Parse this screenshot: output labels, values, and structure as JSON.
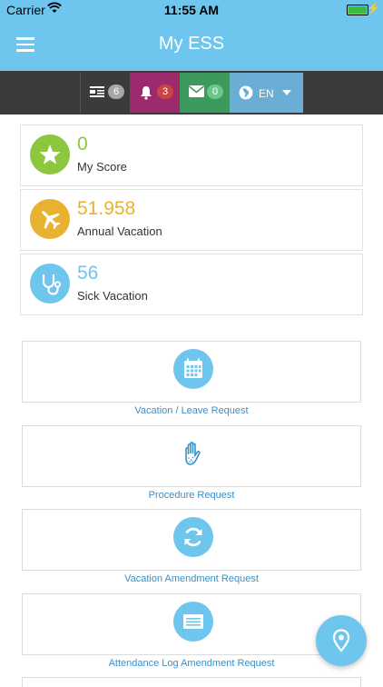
{
  "status_bar": {
    "carrier": "Carrier",
    "time": "11:55 AM"
  },
  "app": {
    "title": "My ESS"
  },
  "toolbar": {
    "news_count": "6",
    "notifications_count": "3",
    "messages_count": "0",
    "language": "EN"
  },
  "stats": [
    {
      "value": "0",
      "label": "My Score",
      "color": "#8dc63f"
    },
    {
      "value": "51.958",
      "label": "Annual Vacation",
      "color": "#e8b130"
    },
    {
      "value": "56",
      "label": "Sick Vacation",
      "color": "#6ec6ee"
    }
  ],
  "requests": [
    {
      "label": "Vacation / Leave Request",
      "icon": "calendar-icon"
    },
    {
      "label": "Procedure Request",
      "icon": "hand-icon"
    },
    {
      "label": "Vacation Amendment Request",
      "icon": "refresh-icon"
    },
    {
      "label": "Attendance Log Amendment Request",
      "icon": "card-icon"
    }
  ],
  "colors": {
    "primary": "#6ec6ee",
    "link": "#3a8fc8",
    "toolbar_bg": "#3b3b3b"
  }
}
